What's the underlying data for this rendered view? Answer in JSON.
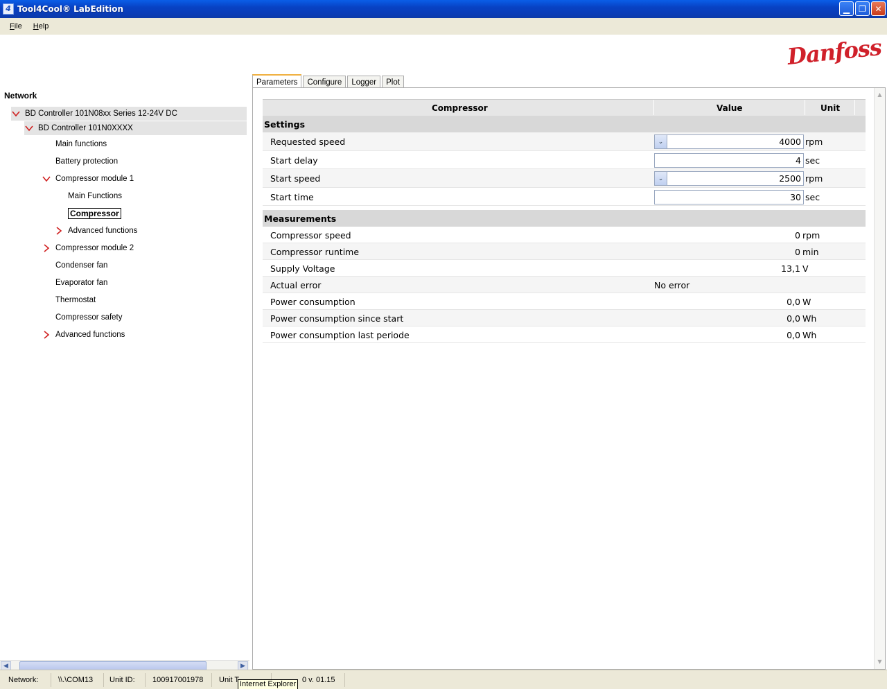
{
  "window": {
    "title": "Tool4Cool® LabEdition",
    "icon": "app-icon"
  },
  "menu": [
    {
      "label": "File",
      "accel": "F",
      "rest": "ile"
    },
    {
      "label": "Help",
      "accel": "H",
      "rest": "elp"
    }
  ],
  "logo": "Danfoss",
  "sidebar": {
    "title": "Network",
    "tree": [
      {
        "label": "BD Controller 101N08xx Series 12-24V DC",
        "expander": "expanded"
      },
      {
        "label": "BD Controller 101N0XXXX",
        "expander": "expanded"
      },
      {
        "label": "Main functions",
        "expander": "none"
      },
      {
        "label": "Battery protection",
        "expander": "none"
      },
      {
        "label": "Compressor module 1",
        "expander": "expanded"
      },
      {
        "label": "Main Functions",
        "expander": "none"
      },
      {
        "label": "Compressor",
        "expander": "none",
        "selected": true
      },
      {
        "label": "Advanced functions",
        "expander": "collapsed"
      },
      {
        "label": "Compressor module 2",
        "expander": "collapsed"
      },
      {
        "label": "Condenser fan",
        "expander": "none"
      },
      {
        "label": "Evaporator fan",
        "expander": "none"
      },
      {
        "label": "Thermostat",
        "expander": "none"
      },
      {
        "label": "Compressor safety",
        "expander": "none"
      },
      {
        "label": "Advanced functions",
        "expander": "collapsed"
      }
    ]
  },
  "tabs": [
    {
      "label": "Parameters",
      "active": true
    },
    {
      "label": "Configure",
      "active": false
    },
    {
      "label": "Logger",
      "active": false
    },
    {
      "label": "Plot",
      "active": false
    }
  ],
  "grid": {
    "headers": {
      "name": "Compressor",
      "value": "Value",
      "unit": "Unit"
    },
    "settings_title": "Settings",
    "settings": [
      {
        "label": "Requested speed",
        "value": "4000",
        "unit": "rpm",
        "dropdown": true
      },
      {
        "label": "Start delay",
        "value": "4",
        "unit": "sec",
        "dropdown": false
      },
      {
        "label": "Start speed",
        "value": "2500",
        "unit": "rpm",
        "dropdown": true
      },
      {
        "label": "Start time",
        "value": "30",
        "unit": "sec",
        "dropdown": false
      }
    ],
    "measurements_title": "Measurements",
    "measurements": [
      {
        "label": "Compressor speed",
        "value": "0",
        "unit": "rpm"
      },
      {
        "label": "Compressor runtime",
        "value": "0",
        "unit": "min"
      },
      {
        "label": "Supply Voltage",
        "value": "13,1",
        "unit": "V"
      },
      {
        "label": "Actual error",
        "text": "No error"
      },
      {
        "label": "Power consumption",
        "value": "0,0",
        "unit": "W"
      },
      {
        "label": "Power consumption since start",
        "value": "0,0",
        "unit": "Wh"
      },
      {
        "label": "Power consumption last periode",
        "value": "0,0",
        "unit": "Wh"
      }
    ]
  },
  "status": {
    "network_label": "Network:",
    "network_value": "\\\\.\\COM13",
    "unit_id_label": "Unit ID:",
    "unit_id_value": "100917001978",
    "unit_type_label": "Unit T",
    "unit_type_value": "0 v. 01.15",
    "tooltip": "Internet Explorer"
  }
}
